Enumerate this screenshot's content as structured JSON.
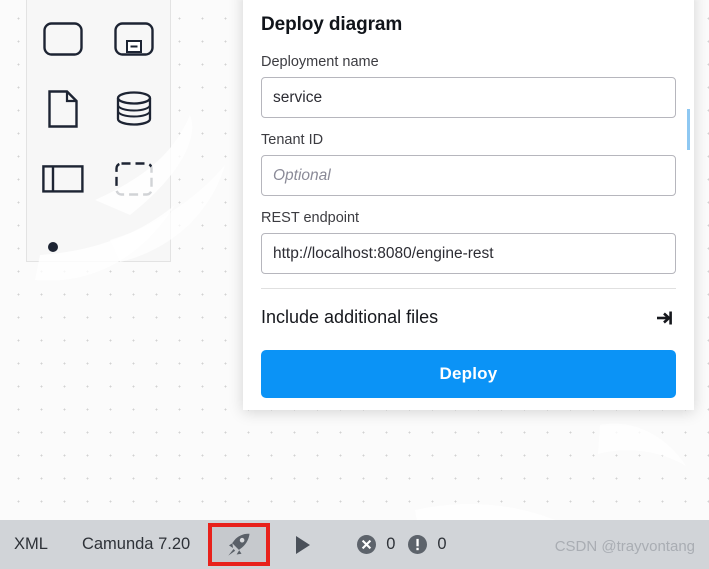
{
  "dialog": {
    "title": "Deploy diagram",
    "fields": [
      {
        "label": "Deployment name",
        "value": "service",
        "placeholder": "",
        "name": "deployment-name"
      },
      {
        "label": "Tenant ID",
        "value": "",
        "placeholder": "Optional",
        "name": "tenant-id"
      },
      {
        "label": "REST endpoint",
        "value": "http://localhost:8080/engine-rest",
        "placeholder": "",
        "name": "rest-endpoint"
      }
    ],
    "include_section_label": "Include additional files",
    "include_section_icon": "expand-arrow-icon",
    "deploy_label": "Deploy",
    "accent_color": "#0b93f6"
  },
  "statusbar": {
    "xml_label": "XML",
    "engine_label": "Camunda 7.20",
    "deploy_icon": "rocket-icon",
    "deploy_icon_highlight_color": "#e8211b",
    "run_icon": "play-icon",
    "error_icon": "error-circle-icon",
    "error_count": "0",
    "warning_icon": "warning-circle-icon",
    "warning_count": "0",
    "background_color": "#d1d4d8"
  },
  "palette": {
    "items": [
      {
        "name": "task-shape",
        "icon": "rounded-rectangle-icon"
      },
      {
        "name": "subprocess-collapsed-shape",
        "icon": "subprocess-icon"
      },
      {
        "name": "data-object-shape",
        "icon": "document-icon"
      },
      {
        "name": "data-store-shape",
        "icon": "database-cylinder-icon"
      },
      {
        "name": "participant-pool-shape",
        "icon": "pool-icon"
      },
      {
        "name": "group-shape",
        "icon": "dashed-rectangle-icon"
      },
      {
        "name": "create-element-dot",
        "icon": "dot-icon"
      }
    ]
  },
  "watermark": {
    "text": "CSDN @trayvontang"
  }
}
